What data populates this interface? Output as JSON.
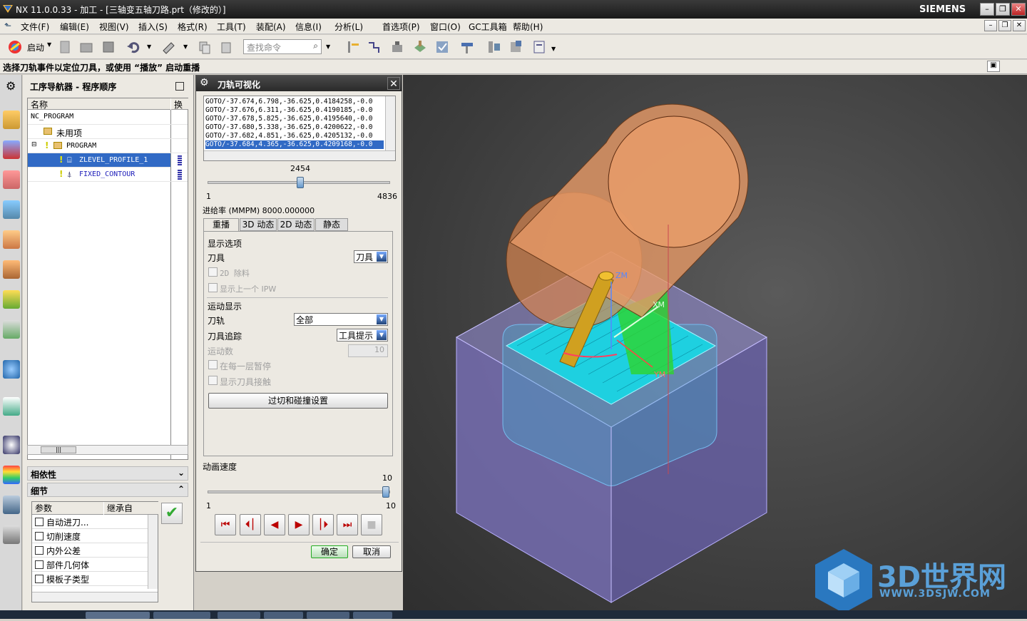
{
  "window": {
    "title": "NX 11.0.0.33 - 加工 - [三轴变五轴刀路.prt（修改的）]",
    "brand": "SIEMENS"
  },
  "menu": {
    "items": [
      "文件(F)",
      "编辑(E)",
      "视图(V)",
      "插入(S)",
      "格式(R)",
      "工具(T)",
      "装配(A)",
      "信息(I)",
      "分析(L)",
      "首选项(P)",
      "窗口(O)",
      "GC工具箱",
      "帮助(H)"
    ]
  },
  "toolbar": {
    "start_label": "启动",
    "search_placeholder": "查找命令"
  },
  "status": {
    "message": "选择刀轨事件以定位刀具，或使用 “播放” 启动重播"
  },
  "navigator": {
    "title": "工序导航器 - 程序顺序",
    "col_name": "名称",
    "col_change": "换刀",
    "rows": [
      {
        "label": "NC_PROGRAM"
      },
      {
        "label": "未用项"
      },
      {
        "label": "PROGRAM"
      },
      {
        "label": "ZLEVEL_PROFILE_1"
      },
      {
        "label": "FIXED_CONTOUR"
      }
    ],
    "dependencies_label": "相依性",
    "details_label": "细节",
    "details_col_param": "参数",
    "details_col_inherit": "继承自",
    "details_rows": [
      "自动进刀...",
      "切削速度",
      "内外公差",
      "部件几何体",
      "模板子类型"
    ]
  },
  "dialog": {
    "title": "刀轨可视化",
    "goto_lines": [
      "GOTO/-37.674,6.798,-36.625,0.4184258,-0.0",
      "GOTO/-37.676,6.311,-36.625,0.4190185,-0.0",
      "GOTO/-37.678,5.825,-36.625,0.4195640,-0.0",
      "GOTO/-37.680,5.338,-36.625,0.4200622,-0.0",
      "GOTO/-37.682,4.851,-36.625,0.4205132,-0.0",
      "GOTO/-37.684,4.365,-36.625,0.4209168,-0.0"
    ],
    "position_value": "2454",
    "position_min": "1",
    "position_max": "4836",
    "position_fraction": 0.507,
    "feed_rate": "进给率 (MMPM) 8000.000000",
    "tabs": [
      "重播",
      "3D 动态",
      "2D 动态",
      "静态"
    ],
    "display_options_label": "显示选项",
    "tool_label": "刀具",
    "tool_value": "刀具",
    "remove_2d_label": "2D 除料",
    "show_prev_ipw_label": "显示上一个 IPW",
    "motion_display_label": "运动显示",
    "toolpath_label": "刀轨",
    "toolpath_value": "全部",
    "tool_trace_label": "刀具追踪",
    "tool_trace_value": "工具提示",
    "motion_count_label": "运动数",
    "motion_count_value": "10",
    "pause_each_layer_label": "在每一层暂停",
    "show_tool_contact_label": "显示刀具接触",
    "gouge_button": "过切和碰撞设置",
    "anim_speed_label": "动画速度",
    "speed_value": "10",
    "speed_min": "1",
    "speed_max": "10",
    "speed_fraction": 1.0,
    "ok_label": "确定",
    "cancel_label": "取消"
  },
  "viewport": {
    "axis_labels": [
      "ZM",
      "XM",
      "YM"
    ],
    "watermark": "3D世界网",
    "watermark_url": "WWW.3DSJW.COM"
  },
  "colors": {
    "titlebar": "#1a1a1a",
    "selection": "#316ac5",
    "holder": "#d98a55",
    "stock": "#8a7fcf",
    "toolpath": "#22c8d8"
  }
}
